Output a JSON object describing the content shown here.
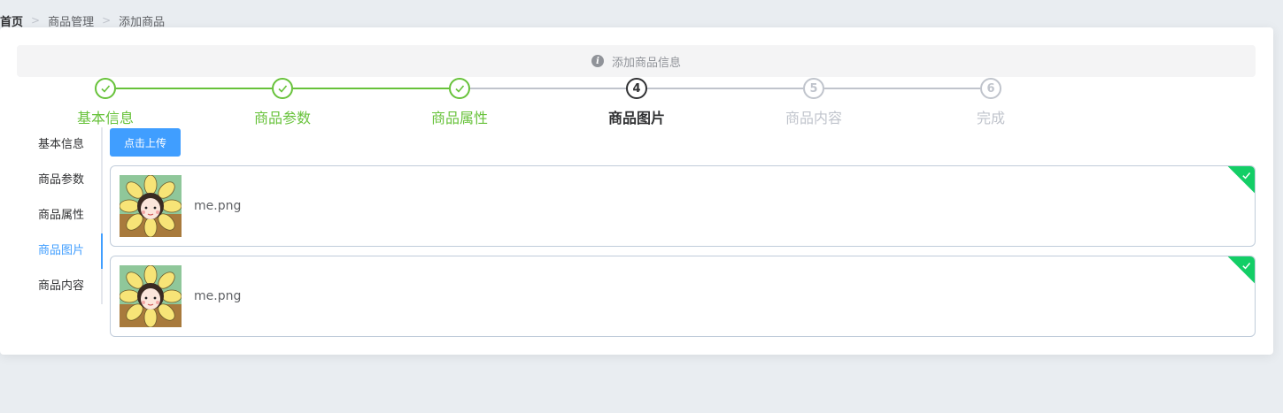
{
  "breadcrumb": {
    "home": "首页",
    "items": [
      "商品管理",
      "添加商品"
    ]
  },
  "alert": {
    "text": "添加商品信息",
    "icon": "info-icon"
  },
  "steps": [
    {
      "title": "基本信息",
      "number": "1",
      "status": "done"
    },
    {
      "title": "商品参数",
      "number": "2",
      "status": "done"
    },
    {
      "title": "商品属性",
      "number": "3",
      "status": "done"
    },
    {
      "title": "商品图片",
      "number": "4",
      "status": "active"
    },
    {
      "title": "商品内容",
      "number": "5",
      "status": "wait"
    },
    {
      "title": "完成",
      "number": "6",
      "status": "wait"
    }
  ],
  "tabs": [
    {
      "label": "基本信息",
      "active": false
    },
    {
      "label": "商品参数",
      "active": false
    },
    {
      "label": "商品属性",
      "active": false
    },
    {
      "label": "商品图片",
      "active": true
    },
    {
      "label": "商品内容",
      "active": false
    }
  ],
  "upload": {
    "button_label": "点击上传"
  },
  "files": [
    {
      "name": "me.png",
      "status": "success"
    },
    {
      "name": "me.png",
      "status": "success"
    }
  ],
  "colors": {
    "success": "#67c23a",
    "primary": "#409eff",
    "upload_success": "#13ce66",
    "wait": "#c0c4cc"
  }
}
